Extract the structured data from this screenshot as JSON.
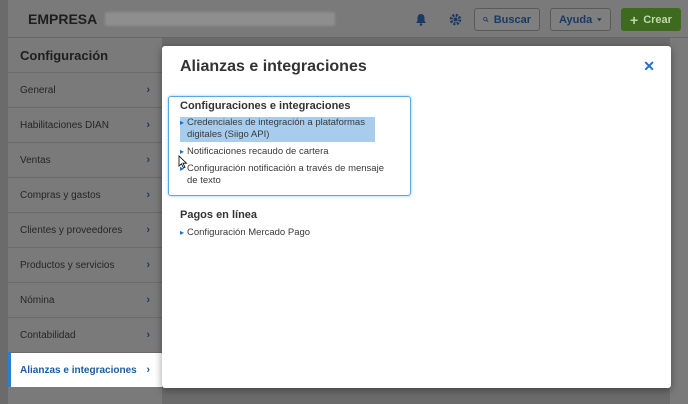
{
  "topbar": {
    "company": "EMPRESA",
    "search_label": "Buscar",
    "help_label": "Ayuda",
    "create_label": "Crear"
  },
  "sidebar": {
    "title": "Configuración",
    "items": [
      {
        "label": "General"
      },
      {
        "label": "Habilitaciones DIAN"
      },
      {
        "label": "Ventas"
      },
      {
        "label": "Compras y gastos"
      },
      {
        "label": "Clientes y proveedores"
      },
      {
        "label": "Productos y servicios"
      },
      {
        "label": "Nómina"
      },
      {
        "label": "Contabilidad"
      },
      {
        "label": "Alianzas e integraciones"
      }
    ]
  },
  "modal": {
    "title": "Alianzas e integraciones",
    "sections": [
      {
        "title": "Configuraciones e integraciones",
        "links": [
          {
            "label_line1": "Credenciales de integración a plataformas",
            "label_line2": "digitales (Siigo API)"
          },
          {
            "label_line1": "Notificaciones recaudo de cartera"
          },
          {
            "label_line1": "Configuración notificación a través de mensaje",
            "label_line2": "de texto"
          }
        ]
      },
      {
        "title": "Pagos en línea",
        "links": [
          {
            "label_line1": "Configuración Mercado Pago"
          }
        ]
      }
    ]
  },
  "colors": {
    "accent": "#1d6fd1",
    "active_sidebar": "#1d5a9e",
    "create_button": "#3d6a1e"
  }
}
